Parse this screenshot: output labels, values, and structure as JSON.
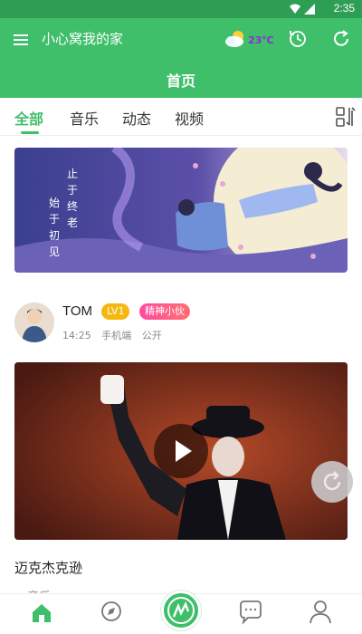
{
  "status_bar": {
    "time": "2:35"
  },
  "app_bar": {
    "menu_icon": "menu-icon",
    "home_name": "小心窝我的家",
    "weather": {
      "icon": "cloud-sun-icon",
      "temperature": "23℃"
    },
    "history_icon": "history-icon",
    "refresh_icon": "refresh-icon",
    "page_title": "首页"
  },
  "tabs": [
    {
      "label": "全部",
      "active": true
    },
    {
      "label": "音乐",
      "active": false
    },
    {
      "label": "动态",
      "active": false
    },
    {
      "label": "视频",
      "active": false
    }
  ],
  "banner": {
    "line1": "止于终老",
    "line2": "始于初见"
  },
  "post": {
    "user": "TOM",
    "level": "LV1",
    "title_badge": "精神小伙",
    "time": "14:25",
    "device": "手机端",
    "visibility": "公开",
    "title": "迈克杰克逊",
    "snippet": "音乐"
  },
  "bottom_nav": [
    {
      "name": "home",
      "icon": "home-icon"
    },
    {
      "name": "discover",
      "icon": "compass-icon"
    },
    {
      "name": "publish",
      "icon": "center-logo-icon"
    },
    {
      "name": "messages",
      "icon": "chat-icon"
    },
    {
      "name": "profile",
      "icon": "person-icon"
    }
  ],
  "colors": {
    "primary": "#3fbf6a",
    "status_bar": "#2f9e55",
    "badge_level": "#f5b80f",
    "badge_title": "#ff4aa0"
  }
}
